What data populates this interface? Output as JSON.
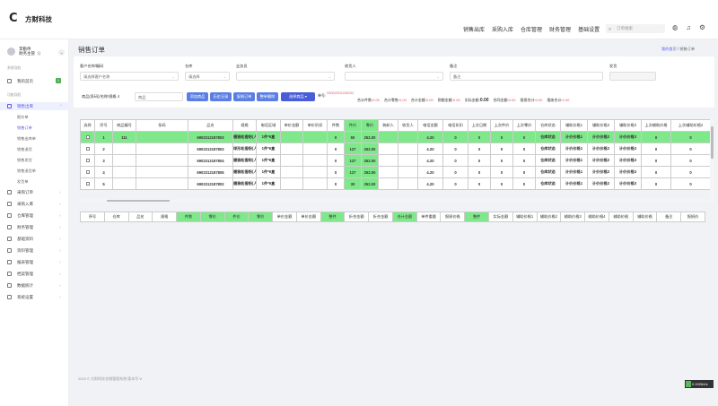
{
  "app": {
    "name": "方财科技"
  },
  "topnav": [
    "销售出库",
    "采购入库",
    "仓库管理",
    "财务管理",
    "基础设置"
  ],
  "search": {
    "placeholder": "订单搜索"
  },
  "sidebar": {
    "user": "李勤伟\n财务主管（）",
    "sec1": "系统导航",
    "sec2": "功能导航",
    "home": "我的首页",
    "home_badge": "1",
    "sales": "销售出库",
    "subs": [
      "报价单",
      "销售订单",
      "销售出库单",
      "销售退货",
      "销售发货",
      "销售退货单",
      "发货单"
    ],
    "items": [
      "采购订单",
      "采购入库",
      "仓库管理",
      "财务管理",
      "基础资料",
      "资料管理",
      "报表管理",
      "档案管理",
      "数据统计",
      "系统设置"
    ]
  },
  "page": {
    "title": "销售订单",
    "crumb_home": "我的首页",
    "crumb_cur": "销售订单"
  },
  "filters": {
    "l1": "客户名称/编码",
    "v1": "请选择客户名称",
    "l2": "仓库",
    "v2": "请选择",
    "l3": "业务员",
    "l4": "收货人",
    "l5": "备注",
    "v5": "备注",
    "l6": "发货",
    "ql": "商品(条码)/名称/规格",
    "qnum": "4",
    "qv": "商品",
    "btns": [
      "添加商品",
      "历史记录",
      "复制订单",
      "整单删除",
      "选择商品"
    ],
    "sumlabel": "单号:",
    "sumno": "XSDD202312150012",
    "sums": [
      [
        "合计件数:",
        "0.00"
      ],
      [
        "合计零售:",
        "0.00"
      ],
      [
        "合计金额:",
        "0.00"
      ],
      [
        "税额金额:",
        "0.00"
      ],
      [
        "实际金额:",
        "0.00"
      ],
      [
        "合同金额:",
        "0.00"
      ],
      [
        "报损合计:",
        "0.00"
      ],
      [
        "报废合计:",
        "0.00"
      ]
    ]
  },
  "grid1": {
    "headers": [
      "选择",
      "序号",
      "商品编号",
      "条码",
      "品名",
      "规格",
      "电话区域",
      "单价金额",
      "单价折扣",
      "件数",
      "件价",
      "零价",
      "装卸人",
      "收货人",
      "电话金额",
      "电话折扣",
      "上次日期",
      "上次件价",
      "上次零价",
      "仓库状态",
      "辅助价格1",
      "辅助价格2",
      "辅助价格3",
      "上次辅助价格",
      "上次辅助价格2"
    ],
    "rows": [
      [
        "1",
        "111",
        "6902312187803",
        "健雅松香粉(人民币)",
        "1件*6盒",
        "0",
        "50",
        "252.00",
        "4.20",
        "0",
        "0",
        "0",
        "0",
        "仓库状态",
        "计价价格1",
        "计价价格2",
        "计价价格3",
        "0",
        "0"
      ],
      [
        "2",
        "",
        "6902312187803",
        "球形松香粉(人民币)",
        "1件*6盒",
        "0",
        "127",
        "252.00",
        "4.20",
        "0",
        "0",
        "0",
        "0",
        "仓库状态",
        "计价价格1",
        "计价价格2",
        "计价价格3",
        "0",
        "0"
      ],
      [
        "3",
        "",
        "6902312187804",
        "健雅松香粉(人民币)",
        "1件*6盒",
        "0",
        "127",
        "252.00",
        "4.20",
        "0",
        "0",
        "0",
        "0",
        "仓库状态",
        "计价价格1",
        "计价价格2",
        "计价价格3",
        "0",
        "0"
      ],
      [
        "4",
        "",
        "6902312187805",
        "健雅松香粉(人民币)",
        "1件*6盒",
        "0",
        "127",
        "252.00",
        "4.20",
        "0",
        "0",
        "0",
        "0",
        "仓库状态",
        "计价价格1",
        "计价价格2",
        "计价价格3",
        "0",
        "0"
      ],
      [
        "5",
        "",
        "6902312187802",
        "健雅松香粉(人民币)",
        "1件*6盒",
        "0",
        "30",
        "252.00",
        "4.20",
        "0",
        "0",
        "0",
        "0",
        "仓库状态",
        "计价价格1",
        "计价价格2",
        "计价价格3",
        "0",
        "0"
      ]
    ]
  },
  "grid2": {
    "headers": [
      "序号",
      "仓库",
      "品名",
      "规格",
      "件数",
      "零价",
      "件价",
      "零价",
      "单价金额",
      "单价金额",
      "整件",
      "折合金额",
      "折合金额",
      "合计金额",
      "单件重量",
      "报损价格",
      "整件",
      "实际金额",
      "辅助价格1",
      "辅助价格2",
      "辅助价格3",
      "辅助价格4",
      "辅助价格",
      "辅助价格",
      "备注",
      "报损价"
    ]
  },
  "footer": {
    "text": "2023 © 方财科技仓储管理系统 版本号",
    "ver": "V"
  },
  "corner": "0.19264/s",
  "colors": {
    "accent": "#5a5de6",
    "highlight": "#7ee88a",
    "button": "#5b7ee5"
  }
}
